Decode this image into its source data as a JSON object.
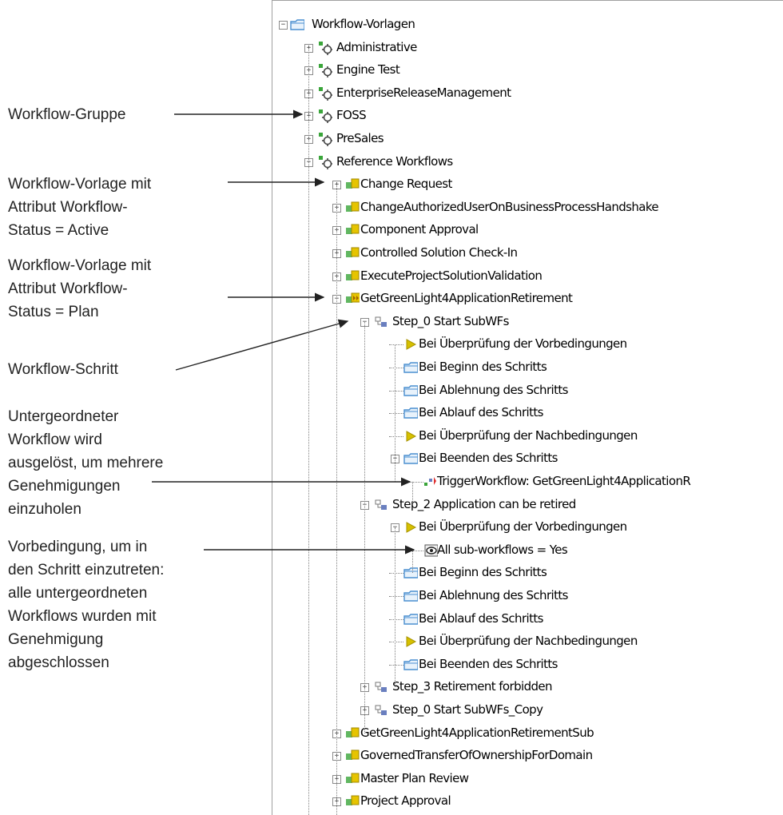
{
  "annotations": [
    {
      "lines": [
        "Workflow-Gruppe"
      ]
    },
    {
      "lines": [
        "Workflow-Vorlage  mit",
        "Attribut Workflow-",
        "Status = Active"
      ]
    },
    {
      "lines": [
        "Workflow-Vorlage  mit",
        "Attribut Workflow-",
        "Status = Plan"
      ]
    },
    {
      "lines": [
        "Workflow-Schritt"
      ]
    },
    {
      "lines": [
        "Untergeordneter",
        "Workflow wird",
        "ausgelöst, um mehrere",
        "Genehmigungen",
        "einzuholen"
      ]
    },
    {
      "lines": [
        "Vorbedingung,  um in",
        "den Schritt einzutreten:",
        "alle untergeordneten",
        "Workflows wurden  mit",
        "Genehmigung",
        "abgeschlossen"
      ]
    }
  ],
  "tree": [
    {
      "label": "Workflow-Vorlagen",
      "icon": "folder-icon",
      "level": 0,
      "expander": "minus"
    },
    {
      "label": "Administrative",
      "icon": "workflow-group-icon",
      "level": 1,
      "expander": "plus"
    },
    {
      "label": "Engine Test",
      "icon": "workflow-group-icon",
      "level": 1,
      "expander": "plus"
    },
    {
      "label": "EnterpriseReleaseManagement",
      "icon": "workflow-group-icon",
      "level": 1,
      "expander": "plus"
    },
    {
      "label": "FOSS",
      "icon": "workflow-group-icon",
      "level": 1,
      "expander": "plus"
    },
    {
      "label": "PreSales",
      "icon": "workflow-group-icon",
      "level": 1,
      "expander": "plus"
    },
    {
      "label": "Reference Workflows",
      "icon": "workflow-group-icon",
      "level": 1,
      "expander": "minus"
    },
    {
      "label": "Change Request",
      "icon": "template-active-icon",
      "level": 2,
      "expander": "plus"
    },
    {
      "label": "ChangeAuthorizedUserOnBusinessProcessHandshake",
      "icon": "template-active-icon",
      "level": 2,
      "expander": "plus"
    },
    {
      "label": "Component Approval",
      "icon": "template-active-icon",
      "level": 2,
      "expander": "plus"
    },
    {
      "label": "Controlled Solution Check-In",
      "icon": "template-active-icon",
      "level": 2,
      "expander": "plus"
    },
    {
      "label": "ExecuteProjectSolutionValidation",
      "icon": "template-active-icon",
      "level": 2,
      "expander": "plus"
    },
    {
      "label": "GetGreenLight4ApplicationRetirement",
      "icon": "template-plan-icon",
      "level": 2,
      "expander": "minus"
    },
    {
      "label": "Step_0 Start SubWFs",
      "icon": "step-icon",
      "level": 3,
      "expander": "minus"
    },
    {
      "label": "Bei Überprüfung der Vorbedingungen",
      "icon": "play-icon",
      "level": 4,
      "expander": "none"
    },
    {
      "label": "Bei Beginn des Schritts",
      "icon": "folder-icon",
      "level": 4,
      "expander": "none"
    },
    {
      "label": "Bei Ablehnung des Schritts",
      "icon": "folder-icon",
      "level": 4,
      "expander": "none"
    },
    {
      "label": "Bei Ablauf des Schritts",
      "icon": "folder-icon",
      "level": 4,
      "expander": "none"
    },
    {
      "label": "Bei Überprüfung der Nachbedingungen",
      "icon": "play-icon",
      "level": 4,
      "expander": "none"
    },
    {
      "label": "Bei Beenden des Schritts",
      "icon": "folder-icon",
      "level": 4,
      "expander": "minus"
    },
    {
      "label": "TriggerWorkflow: GetGreenLight4ApplicationR",
      "icon": "trigger-icon",
      "level": 5,
      "expander": "none"
    },
    {
      "label": "Step_2 Application can be retired",
      "icon": "step-icon",
      "level": 3,
      "expander": "minus"
    },
    {
      "label": "Bei Überprüfung der Vorbedingungen",
      "icon": "play-icon",
      "level": 4,
      "expander": "minus"
    },
    {
      "label": "All sub-workflows = Yes",
      "icon": "eye-icon",
      "level": 5,
      "expander": "none"
    },
    {
      "label": "Bei Beginn des Schritts",
      "icon": "folder-icon",
      "level": 4,
      "expander": "none"
    },
    {
      "label": "Bei Ablehnung des Schritts",
      "icon": "folder-icon",
      "level": 4,
      "expander": "none"
    },
    {
      "label": "Bei Ablauf des Schritts",
      "icon": "folder-icon",
      "level": 4,
      "expander": "none"
    },
    {
      "label": "Bei Überprüfung der Nachbedingungen",
      "icon": "play-icon",
      "level": 4,
      "expander": "none"
    },
    {
      "label": "Bei Beenden des Schritts",
      "icon": "folder-icon",
      "level": 4,
      "expander": "none"
    },
    {
      "label": "Step_3 Retirement forbidden",
      "icon": "step-icon",
      "level": 3,
      "expander": "plus"
    },
    {
      "label": "Step_0 Start SubWFs_Copy",
      "icon": "step-icon",
      "level": 3,
      "expander": "plus"
    },
    {
      "label": "GetGreenLight4ApplicationRetirementSub",
      "icon": "template-active-icon",
      "level": 2,
      "expander": "plus"
    },
    {
      "label": "GovernedTransferOfOwnershipForDomain",
      "icon": "template-active-icon",
      "level": 2,
      "expander": "plus"
    },
    {
      "label": "Master Plan Review",
      "icon": "template-active-icon",
      "level": 2,
      "expander": "plus"
    },
    {
      "label": "Project Approval",
      "icon": "template-active-icon",
      "level": 2,
      "expander": "plus"
    }
  ],
  "colors": {
    "folder": "#4a8fd0",
    "gear": "#444444",
    "green": "#3aa53a",
    "template": "#e6c400",
    "play": "#d6c000",
    "trigger": "#e03030",
    "line": "#222222"
  }
}
